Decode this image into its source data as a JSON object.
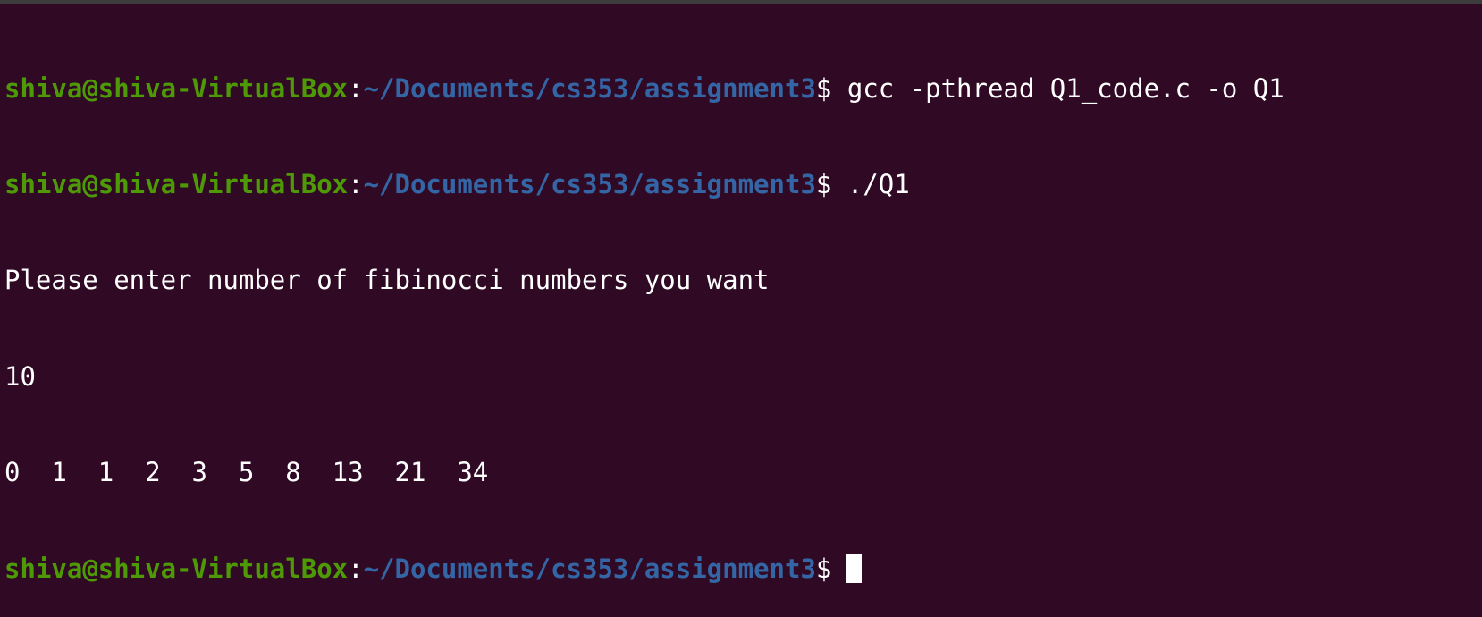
{
  "colors": {
    "background": "#300a24",
    "prompt_user": "#4e9a06",
    "prompt_path": "#3465a4",
    "text": "#ffffff"
  },
  "prompt": {
    "user_host": "shiva@shiva-VirtualBox",
    "separator": ":",
    "path": "~/Documents/cs353/assignment3",
    "symbol": "$"
  },
  "lines": {
    "cmd1": " gcc -pthread Q1_code.c -o Q1",
    "cmd2": " ./Q1",
    "output1": "Please enter number of fibinocci numbers you want",
    "input1": "10",
    "output2": "0  1  1  2  3  5  8  13  21  34"
  }
}
